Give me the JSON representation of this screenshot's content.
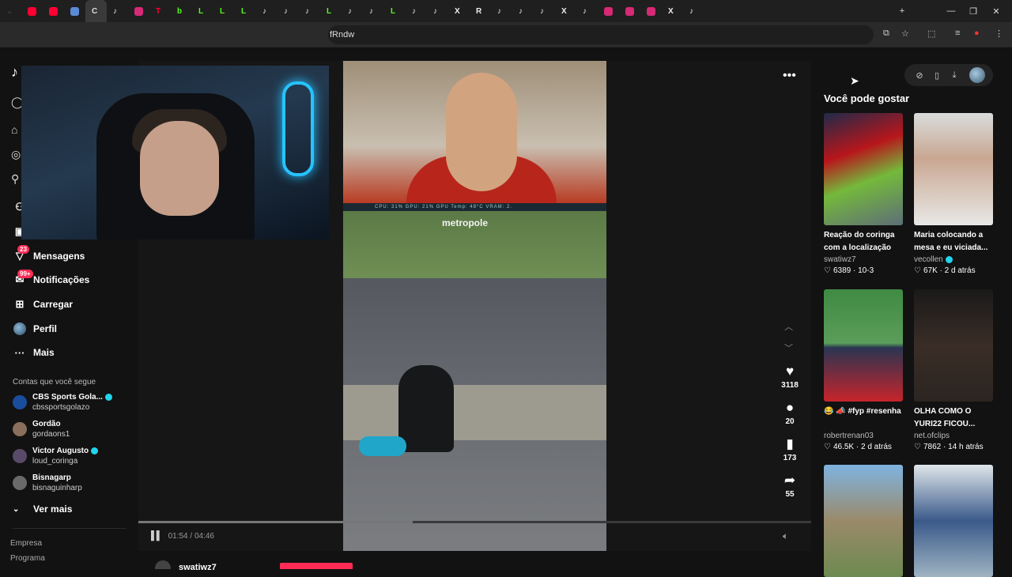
{
  "browser": {
    "tabs": [
      {
        "color": "#3a3a3a",
        "glyph": "⌄"
      },
      {
        "color": "#ff0033",
        "glyph": ""
      },
      {
        "color": "#ff0033",
        "glyph": ""
      },
      {
        "color": "#5b8bd6",
        "glyph": ""
      },
      {
        "color": "#dddddd",
        "glyph": "C"
      },
      {
        "color": "#eeeeee",
        "glyph": "♪"
      },
      {
        "color": "#d62976",
        "glyph": ""
      },
      {
        "color": "#ff0033",
        "glyph": "T"
      },
      {
        "color": "#53fc18",
        "glyph": "b"
      },
      {
        "color": "#53fc18",
        "glyph": "L"
      },
      {
        "color": "#53fc18",
        "glyph": "L"
      },
      {
        "color": "#53fc18",
        "glyph": "L"
      },
      {
        "color": "#eeeeee",
        "glyph": "♪"
      },
      {
        "color": "#eeeeee",
        "glyph": "♪"
      },
      {
        "color": "#eeeeee",
        "glyph": "♪"
      },
      {
        "color": "#53fc18",
        "glyph": "L"
      },
      {
        "color": "#eeeeee",
        "glyph": "♪"
      },
      {
        "color": "#eeeeee",
        "glyph": "♪"
      },
      {
        "color": "#53fc18",
        "glyph": "L"
      },
      {
        "color": "#eeeeee",
        "glyph": "♪"
      },
      {
        "color": "#eeeeee",
        "glyph": "♪"
      },
      {
        "color": "#eeeeee",
        "glyph": "X"
      },
      {
        "color": "#eeeeee",
        "glyph": "R"
      },
      {
        "color": "#eeeeee",
        "glyph": "♪"
      },
      {
        "color": "#eeeeee",
        "glyph": "♪"
      },
      {
        "color": "#eeeeee",
        "glyph": "♪"
      },
      {
        "color": "#eeeeee",
        "glyph": "X"
      },
      {
        "color": "#eeeeee",
        "glyph": "♪"
      },
      {
        "color": "#d62976",
        "glyph": ""
      },
      {
        "color": "#d62976",
        "glyph": ""
      },
      {
        "color": "#d62976",
        "glyph": ""
      },
      {
        "color": "#eeeeee",
        "glyph": "X"
      },
      {
        "color": "#eeeeee",
        "glyph": "♪"
      }
    ],
    "url_tail": "fRndw"
  },
  "sidebar": {
    "nav": [
      {
        "label": "Amigos",
        "icon": "friends-icon",
        "glyph": "⚇"
      },
      {
        "label": "LIVE",
        "icon": "live-icon",
        "glyph": "▣"
      },
      {
        "label": "Mensagens",
        "icon": "messages-icon",
        "glyph": "▽",
        "badge": "23"
      },
      {
        "label": "Notificações",
        "icon": "notifications-icon",
        "glyph": "✉",
        "badge": "99+"
      },
      {
        "label": "Carregar",
        "icon": "upload-icon",
        "glyph": "⊞"
      },
      {
        "label": "Perfil",
        "icon": "profile-avatar",
        "glyph": ""
      },
      {
        "label": "Mais",
        "icon": "more-icon",
        "glyph": "···"
      }
    ],
    "following_title": "Contas que você segue",
    "following": [
      {
        "name": "CBS Sports Gola...",
        "handle": "cbssportsgolazo",
        "verified": true,
        "color": "#1a4d9e"
      },
      {
        "name": "Gordão",
        "handle": "gordaons1",
        "verified": false,
        "color": "#8a6f5c"
      },
      {
        "name": "Victor Augusto",
        "handle": "loud_coringa",
        "verified": true,
        "color": "#5a4a6a"
      },
      {
        "name": "Bisnagarp",
        "handle": "bisnaguinharp",
        "verified": false,
        "color": "#6a6a6a"
      }
    ],
    "see_more": "Ver mais",
    "footer": [
      "Empresa",
      "Programa"
    ]
  },
  "player": {
    "actions": [
      {
        "icon": "heart-icon",
        "glyph": "♥",
        "count": "3118"
      },
      {
        "icon": "comment-icon",
        "glyph": "●",
        "count": "20"
      },
      {
        "icon": "bookmark-icon",
        "glyph": "▮",
        "count": "173"
      },
      {
        "icon": "share-icon",
        "glyph": "➦",
        "count": "55"
      }
    ],
    "progress_fraction": 0.408,
    "time": "01:54 / 04:46",
    "stats_overlay": "CPU: 31%    GPU: 21%    GPU Temp: 48°C    VRAM: 2.",
    "overlay_logo": "metropole",
    "author": "swatiwz7"
  },
  "right_panel": {
    "title": "Você pode gostar",
    "cards": [
      {
        "title": "Reação do coringa com a localização d...",
        "user": "swatiwz7",
        "likes": "6389",
        "date": "10-3",
        "verified": false,
        "thumb": "linear-gradient(160deg,#1f2a4a 0%,#b7161b 35%,#74b93b 60%,#5e6d78 100%)"
      },
      {
        "title": "Maria colocando a mesa e eu viciada...",
        "user": "vecollen",
        "likes": "67K",
        "date": "2 d atrás",
        "verified": true,
        "thumb": "linear-gradient(180deg,#d9dcdc 0%,#c9a792 40%,#e8e8e6 100%)"
      },
      {
        "title": "😂 📣 #fyp #resenha",
        "user": "robertrenan03",
        "likes": "46.5K",
        "date": "2 d atrás",
        "verified": false,
        "thumb": "linear-gradient(180deg,#3f8a43 0%,#5b9d5a 48%,#2a3552 52%,#c7242a 100%)"
      },
      {
        "title": "OLHA COMO O YURI22 FICOU...",
        "user": "net.ofclips",
        "likes": "7862",
        "date": "14 h atrás",
        "verified": false,
        "thumb": "linear-gradient(180deg,#1a1a1a 0%,#3a2d26 50%,#2b2521 100%)"
      },
      {
        "title": "",
        "user": "",
        "likes": "",
        "date": "",
        "verified": false,
        "thumb": "linear-gradient(180deg,#7fb3e0 0%,#9a8a6a 50%,#6d8a50 100%)"
      },
      {
        "title": "",
        "user": "",
        "likes": "",
        "date": "",
        "verified": false,
        "thumb": "linear-gradient(180deg,#dfe6ea 0%,#3a5a8a 50%,#9fb3c2 100%)"
      }
    ]
  }
}
